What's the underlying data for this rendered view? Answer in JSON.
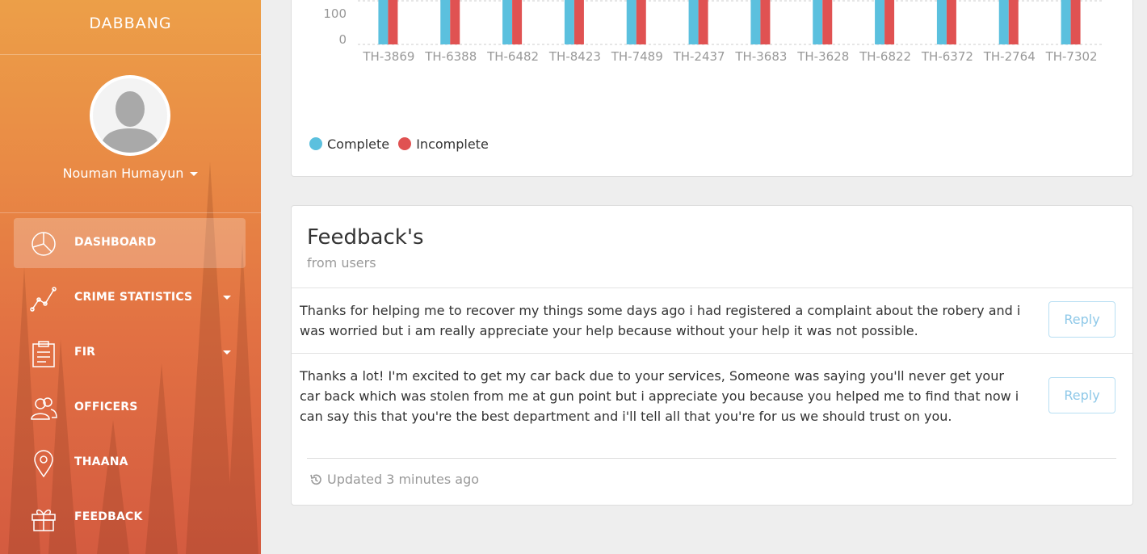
{
  "sidebar": {
    "brand": "DABBANG",
    "user_name": "Nouman Humayun",
    "items": [
      {
        "label": "DASHBOARD",
        "icon": "pie-chart-icon",
        "active": true
      },
      {
        "label": "CRIME STATISTICS",
        "icon": "line-chart-icon",
        "dropdown": true
      },
      {
        "label": "FIR",
        "icon": "clipboard-icon",
        "dropdown": true
      },
      {
        "label": "OFFICERS",
        "icon": "users-icon"
      },
      {
        "label": "THAANA",
        "icon": "map-pin-icon"
      },
      {
        "label": "FEEDBACK",
        "icon": "gift-icon"
      }
    ]
  },
  "chart_data": {
    "type": "bar",
    "categories": [
      "TH-3869",
      "TH-6388",
      "TH-6482",
      "TH-8423",
      "TH-7489",
      "TH-2437",
      "TH-3683",
      "TH-3628",
      "TH-6822",
      "TH-6372",
      "TH-2764",
      "TH-7302"
    ],
    "y_ticks": [
      "100",
      "0"
    ],
    "series": [
      {
        "name": "Complete",
        "color": "#5bc0de"
      },
      {
        "name": "Incomplete",
        "color": "#e05252"
      }
    ],
    "legend": [
      "Complete",
      "Incomplete"
    ]
  },
  "feedback": {
    "title": "Feedback's",
    "subtitle": "from users",
    "items": [
      {
        "text": "Thanks for helping me to recover my things some days ago i had registered a complaint about the robery and i was worried but i am really appreciate your help because without your help it was not possible.",
        "reply": "Reply"
      },
      {
        "text": "Thanks a lot! I'm excited to get my car back due to your services, Someone was saying you'll never get your car back which was stolen from me at gun point but i appreciate you because you helped me to find that now i can say this that you're the best department and i'll tell all that you're for us we should trust on you.",
        "reply": "Reply"
      }
    ],
    "footer": "Updated 3 minutes ago"
  }
}
